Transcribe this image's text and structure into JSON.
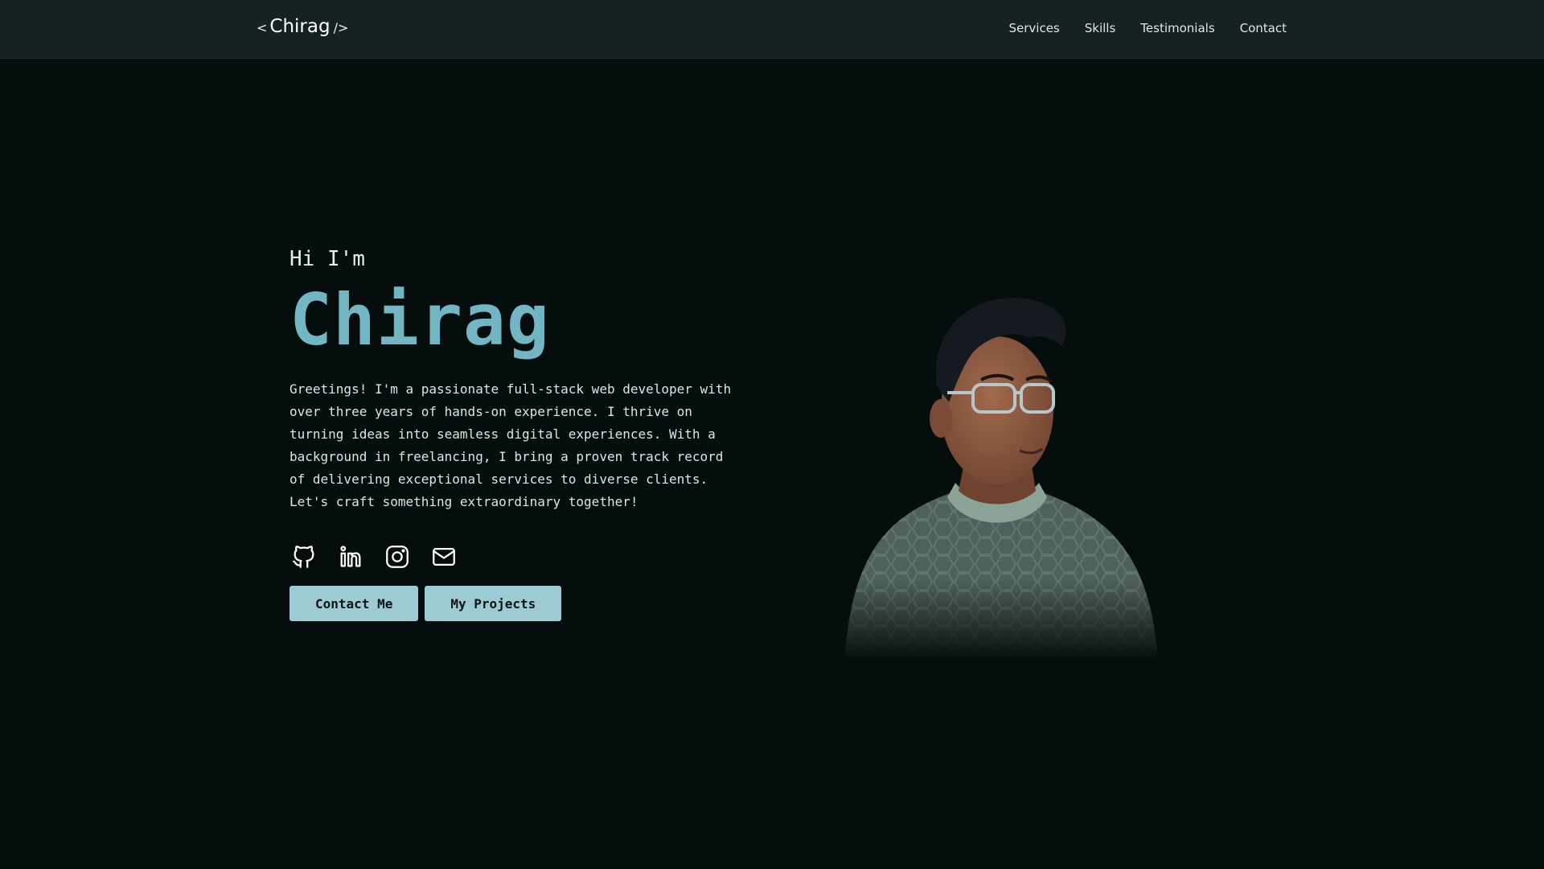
{
  "brand": {
    "open_bracket": "<",
    "name": "Chirag",
    "close_bracket": "/>"
  },
  "nav": {
    "items": [
      {
        "label": "Services"
      },
      {
        "label": "Skills"
      },
      {
        "label": "Testimonials"
      },
      {
        "label": "Contact"
      }
    ]
  },
  "hero": {
    "greeting": "Hi I'm",
    "name": "Chirag",
    "bio": "Greetings! I'm a passionate full-stack web developer with over three years of hands-on experience. I thrive on turning ideas into seamless digital experiences. With a background in freelancing, I bring a proven track record of delivering exceptional services to diverse clients. Let's craft something extraordinary together!",
    "socials": [
      {
        "icon": "github-icon"
      },
      {
        "icon": "linkedin-icon"
      },
      {
        "icon": "instagram-icon"
      },
      {
        "icon": "mail-icon"
      }
    ],
    "buttons": {
      "contact": "Contact Me",
      "projects": "My Projects"
    }
  },
  "colors": {
    "background": "#060d0d",
    "navbar": "#162122",
    "accent": "#72b6c3",
    "button": "#9ccbd3"
  }
}
